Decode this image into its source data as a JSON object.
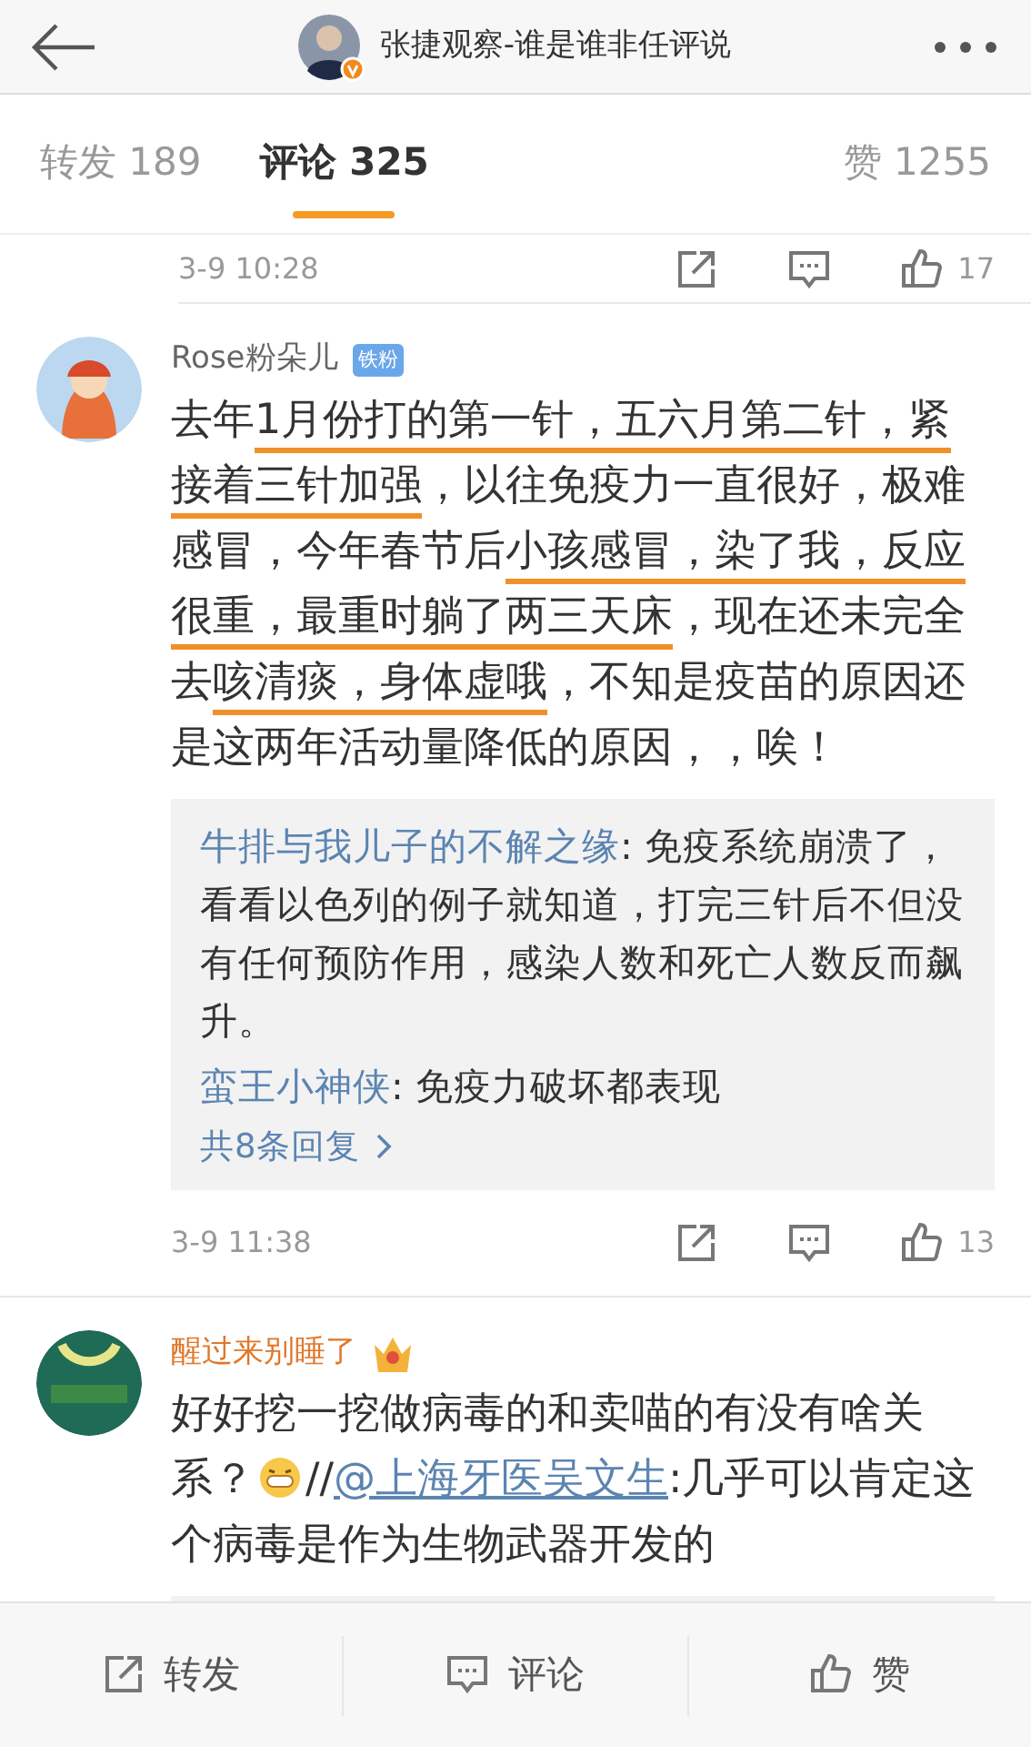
{
  "header": {
    "title": "张捷观察-谁是谁非任评说"
  },
  "tabs": [
    {
      "label": "转发",
      "count": "189",
      "selected": false
    },
    {
      "label": "评论",
      "count": "325",
      "selected": true
    },
    {
      "label": "赞",
      "count": "1255",
      "selected": false
    }
  ],
  "comments": [
    {
      "kind": "partial",
      "time": "3-9 10:28",
      "likes": "17"
    },
    {
      "kind": "full",
      "user": "Rose粉朵儿",
      "vip": false,
      "badge": "铁粉",
      "body": [
        {
          "kind": "text",
          "text": "去年",
          "underlined": false
        },
        {
          "kind": "text",
          "text": "1月份打的第一针，五六月第二针，紧接着三针加强",
          "underlined": true
        },
        {
          "kind": "text",
          "text": "，以往免疫力一直很好，极难感冒，今年春节后",
          "underlined": false
        },
        {
          "kind": "text",
          "text": "小孩感冒，染了我，反应很重，最重时躺了两三天床",
          "underlined": true
        },
        {
          "kind": "text",
          "text": "，现在还未完全去",
          "underlined": false
        },
        {
          "kind": "text",
          "text": "咳清痰，身体虚哦",
          "underlined": true
        },
        {
          "kind": "text",
          "text": "，不知是疫苗的原因还是这两年活动量降低的原因，，唉！",
          "underlined": false
        }
      ],
      "replies": [
        {
          "user": "牛排与我儿子的不解之缘",
          "text": ": 免疫系统崩溃了，看看以色列的例子就知道，打完三针后不但没有任何预防作用，感染人数和死亡人数反而飙升。"
        },
        {
          "user": "蛮王小神侠",
          "text": ": 免疫力破坏都表现"
        }
      ],
      "more_replies": "共8条回复",
      "time": "3-9 11:38",
      "likes": "13"
    },
    {
      "kind": "full",
      "user": "醒过来别睡了",
      "vip": true,
      "body": [
        {
          "kind": "text",
          "text": "好好挖一挖做病毒的和卖喵的有没有啥关系？",
          "underlined": false
        },
        {
          "kind": "emoji"
        },
        {
          "kind": "text",
          "text": "//",
          "underlined": false
        },
        {
          "kind": "mention",
          "text": "@上海牙医吴文生"
        },
        {
          "kind": "text",
          "text": ":几乎可以肯定这个病毒是作为生物武器开发的",
          "underlined": false
        }
      ],
      "replies_hidden": true
    }
  ],
  "actions": [
    {
      "kind": "share",
      "label": "转发"
    },
    {
      "kind": "comment",
      "label": "评论"
    },
    {
      "kind": "like",
      "label": "赞"
    }
  ]
}
